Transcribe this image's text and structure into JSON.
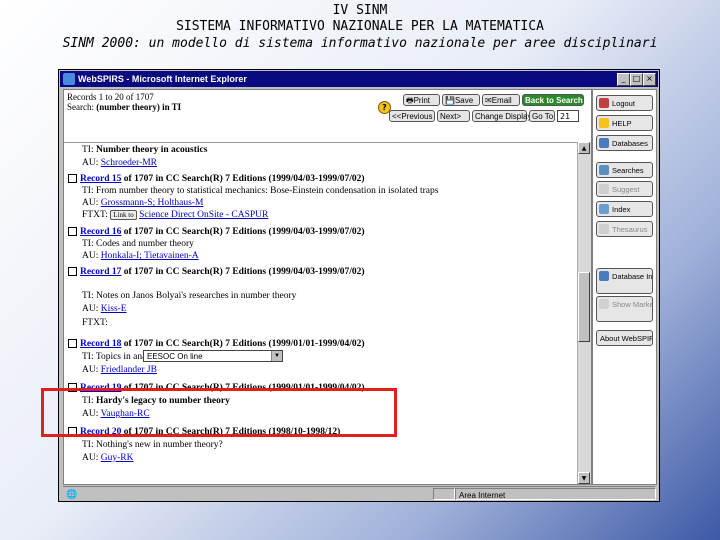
{
  "slide": {
    "title1": "IV SINM",
    "title2": "SISTEMA INFORMATIVO NAZIONALE PER LA MATEMATICA",
    "title3": "SINM 2000: un modello di sistema informativo nazionale per aree disciplinari"
  },
  "window": {
    "title": "WebSPIRS - Microsoft Internet Explorer",
    "controls": [
      "_",
      "□",
      "×"
    ]
  },
  "header": {
    "records_line": "Records 1 to 20 of 1707",
    "search_line_prefix": "Search: ",
    "search_query": "(number theory) in TI"
  },
  "toolbar": {
    "print": "Print",
    "save": "Save",
    "email": "Email",
    "back_to_search": "Back to Search",
    "previous": "<<Previous",
    "next": "Next>",
    "change_display": "Change Display",
    "go_to": "Go To",
    "goto_value": "21"
  },
  "records": [
    {
      "lines": [
        {
          "label": "TI:",
          "text": "Number theory in acoustics"
        },
        {
          "label": "AU:",
          "link": "Schroeder-MR"
        }
      ]
    },
    {
      "num": "Record 15",
      "info": "of 1707 in CC Search(R) 7 Editions (1999/04/03-1999/07/02)",
      "ti": "From number theory to statistical mechanics: Bose-Einstein condensation in isolated traps",
      "au": "Grossmann-S; Holthaus-M",
      "ftxt_label": "FTXT:",
      "ftxt_btn": "Link to",
      "ftxt_link": "Science Direct OnSite - CASPUR"
    },
    {
      "num": "Record 16",
      "info": "of 1707 in CC Search(R) 7 Editions (1999/04/03-1999/07/02)",
      "ti": "Codes and number theory",
      "au": "Honkala-I; Tietavainen-A"
    },
    {
      "num": "Record 17",
      "info": "of 1707 in CC Search(R) 7 Editions (1999/04/03-1999/07/02)",
      "ti": "Notes on Janos Bolyai's researches in number theory",
      "au": "Kiss-E",
      "ftxt_label": "FTXT:",
      "combo": "EESOC On line"
    },
    {
      "num": "Record 18",
      "info": "of 1707 in CC Search(R) 7 Editions (1999/01/01-1999/04/02)",
      "ti": "Topics in analytic number theory",
      "au": "Friedlander JB"
    },
    {
      "num": "Record 19",
      "info": "of 1707 in CC Search(R) 7 Editions (1999/01/01-1999/04/02)",
      "ti": "Hardy's legacy to number theory",
      "au": "Vaughan-RC"
    },
    {
      "num": "Record 20",
      "info": "of 1707 in CC Search(R) 7 Editions (1998/10-1998/12)",
      "ti": "Nothing's new in number theory?",
      "au": "Guy-RK"
    }
  ],
  "sidebar": {
    "logout": "Logout",
    "help": "HELP",
    "databases": "Databases",
    "searches": "Searches",
    "suggest": "Suggest",
    "index": "Index",
    "thesaurus": "Thesaurus",
    "db_info": "Database Information",
    "marked": "Show Marked Records",
    "about": "About WebSPIRS"
  },
  "status": {
    "zone": "Area Internet"
  },
  "colors": {
    "accent_red": "#e02020",
    "link": "#0000cc",
    "titlebar": "#0a0a80"
  }
}
